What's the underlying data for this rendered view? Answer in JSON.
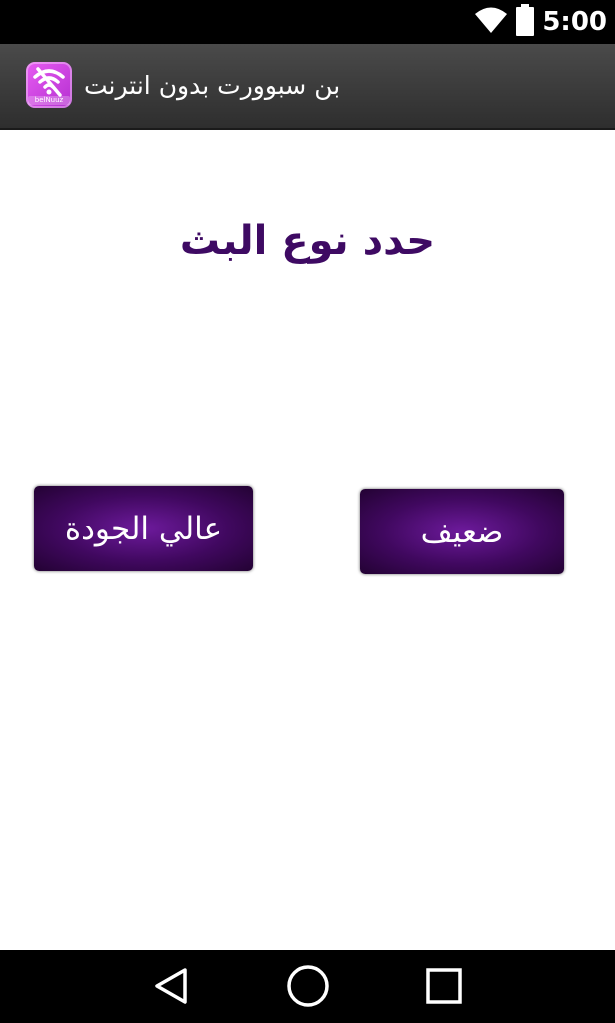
{
  "status_bar": {
    "time": "5:00",
    "icons": [
      "wifi-icon",
      "battery-icon"
    ],
    "background": "#000000"
  },
  "action_bar": {
    "title": "بن سبوورت بدون انترنت",
    "app_icon": "no-wifi-icon",
    "app_icon_label": "belNuuz",
    "background": "#3a3a3a"
  },
  "main": {
    "heading": "حدد نوع البث",
    "heading_color": "#3e0a63",
    "buttons": {
      "high_quality": "عالي الجودة",
      "low_quality": "ضعيف"
    },
    "button_color": "#4a0a6e"
  },
  "nav_bar": {
    "icons": [
      "back-icon",
      "home-icon",
      "recents-icon"
    ]
  }
}
